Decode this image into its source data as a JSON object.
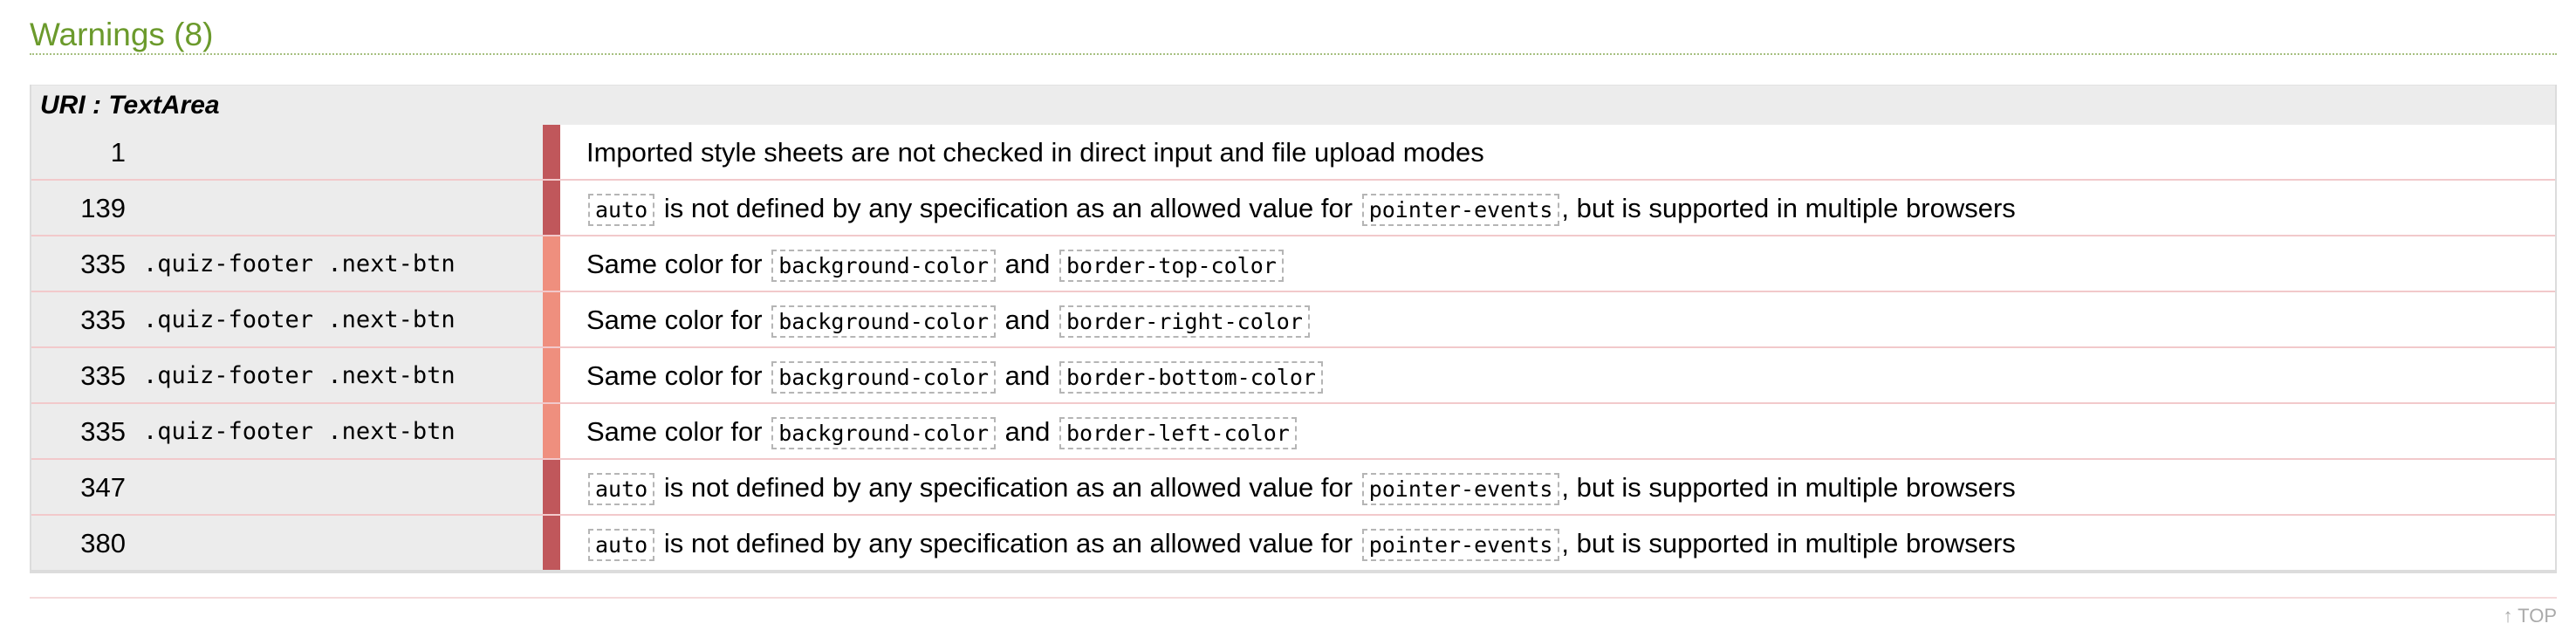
{
  "section": {
    "title": "Warnings (8)"
  },
  "uri_header": "URI : TextArea",
  "rows": [
    {
      "line": "1",
      "selector": "",
      "level": "dark",
      "parts": [
        {
          "t": "text",
          "v": "Imported style sheets are not checked in direct input and file upload modes"
        }
      ]
    },
    {
      "line": "139",
      "selector": "",
      "level": "dark",
      "parts": [
        {
          "t": "code",
          "v": "auto"
        },
        {
          "t": "text",
          "v": " is not defined by any specification as an allowed value for "
        },
        {
          "t": "code",
          "v": "pointer-events"
        },
        {
          "t": "text",
          "v": ", but is supported in multiple browsers"
        }
      ]
    },
    {
      "line": "335",
      "selector": ".quiz-footer .next-btn",
      "level": "light",
      "parts": [
        {
          "t": "text",
          "v": "Same color for "
        },
        {
          "t": "code",
          "v": "background-color"
        },
        {
          "t": "text",
          "v": " and "
        },
        {
          "t": "code",
          "v": "border-top-color"
        }
      ]
    },
    {
      "line": "335",
      "selector": ".quiz-footer .next-btn",
      "level": "light",
      "parts": [
        {
          "t": "text",
          "v": "Same color for "
        },
        {
          "t": "code",
          "v": "background-color"
        },
        {
          "t": "text",
          "v": " and "
        },
        {
          "t": "code",
          "v": "border-right-color"
        }
      ]
    },
    {
      "line": "335",
      "selector": ".quiz-footer .next-btn",
      "level": "light",
      "parts": [
        {
          "t": "text",
          "v": "Same color for "
        },
        {
          "t": "code",
          "v": "background-color"
        },
        {
          "t": "text",
          "v": " and "
        },
        {
          "t": "code",
          "v": "border-bottom-color"
        }
      ]
    },
    {
      "line": "335",
      "selector": ".quiz-footer .next-btn",
      "level": "light",
      "parts": [
        {
          "t": "text",
          "v": "Same color for "
        },
        {
          "t": "code",
          "v": "background-color"
        },
        {
          "t": "text",
          "v": " and "
        },
        {
          "t": "code",
          "v": "border-left-color"
        }
      ]
    },
    {
      "line": "347",
      "selector": "",
      "level": "dark",
      "parts": [
        {
          "t": "code",
          "v": "auto"
        },
        {
          "t": "text",
          "v": " is not defined by any specification as an allowed value for "
        },
        {
          "t": "code",
          "v": "pointer-events"
        },
        {
          "t": "text",
          "v": ", but is supported in multiple browsers"
        }
      ]
    },
    {
      "line": "380",
      "selector": "",
      "level": "dark",
      "parts": [
        {
          "t": "code",
          "v": "auto"
        },
        {
          "t": "text",
          "v": " is not defined by any specification as an allowed value for "
        },
        {
          "t": "code",
          "v": "pointer-events"
        },
        {
          "t": "text",
          "v": ", but is supported in multiple browsers"
        }
      ]
    }
  ],
  "footer": {
    "top_link": "↑ TOP"
  },
  "colors": {
    "title": "#6b9a2c",
    "level_dark": "#c0575b",
    "level_light": "#ef8f7e",
    "row_border": "#f2c9cb",
    "gutter_bg": "#ececec"
  }
}
